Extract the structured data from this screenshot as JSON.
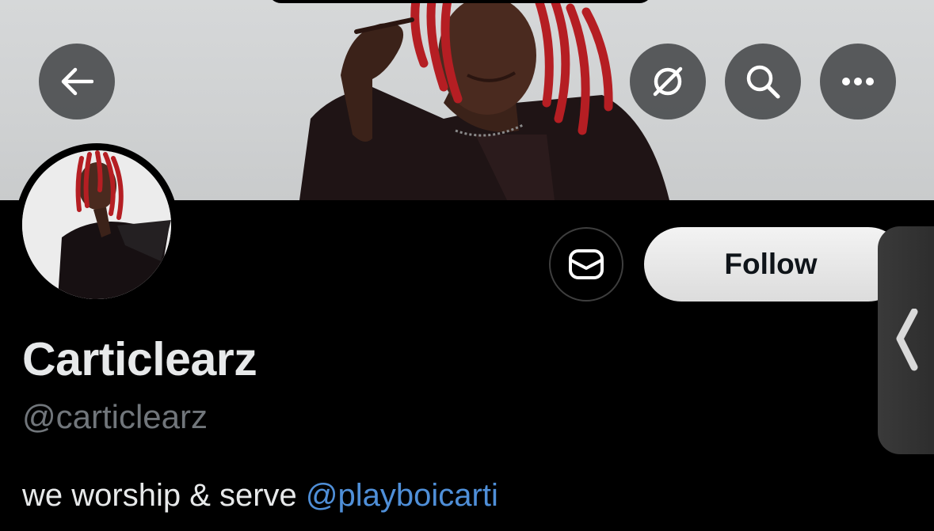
{
  "header": {
    "back_icon": "arrow-left-icon",
    "actions": [
      {
        "name": "grok-icon"
      },
      {
        "name": "search-icon"
      },
      {
        "name": "more-icon"
      }
    ]
  },
  "profile": {
    "display_name": "Carticlearz",
    "handle": "@carticlearz",
    "bio_text": "we worship & serve ",
    "bio_mention": "@playboicarti"
  },
  "actions": {
    "message_icon": "message-icon",
    "follow_label": "Follow"
  },
  "side_panel": {
    "icon": "chevron-left-icon"
  },
  "colors": {
    "background": "#000000",
    "mention": "#4f8fd8",
    "handle_gray": "#71767b",
    "text": "#e7e9ea"
  }
}
